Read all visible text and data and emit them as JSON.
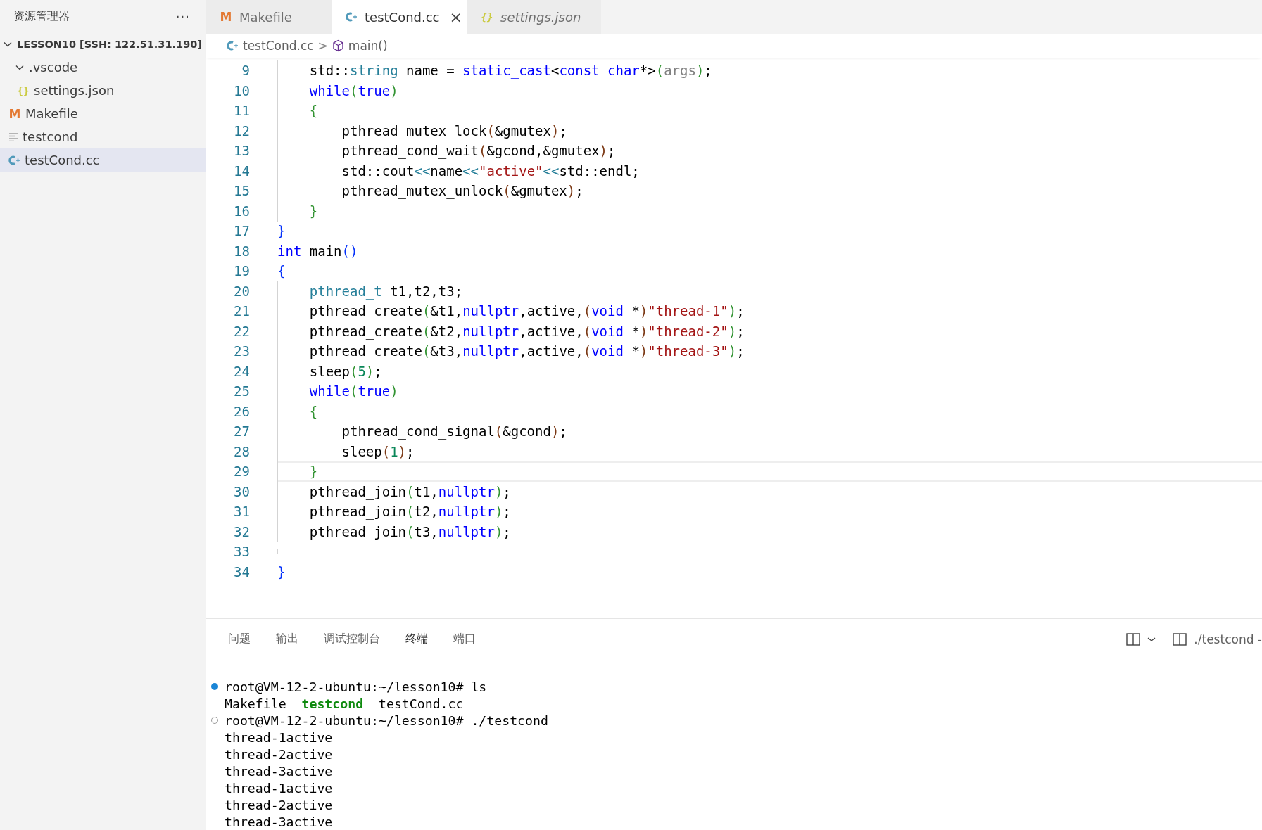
{
  "sidebar": {
    "title": "资源管理器",
    "more": "···",
    "tree": [
      {
        "label": "LESSON10 [SSH: 122.51.31.190]",
        "kind": "root",
        "expanded": true,
        "selected": false,
        "children": [
          {
            "label": ".vscode",
            "kind": "folder",
            "expanded": true,
            "selected": false,
            "children": [
              {
                "label": "settings.json",
                "kind": "json",
                "glyph": "{}",
                "selected": false
              }
            ]
          },
          {
            "label": "Makefile",
            "kind": "make",
            "glyph": "M",
            "selected": false
          },
          {
            "label": "testcond",
            "kind": "plain",
            "selected": false
          },
          {
            "label": "testCond.cc",
            "kind": "cpp",
            "selected": true
          }
        ]
      }
    ]
  },
  "tabs": [
    {
      "label": "Makefile",
      "kind": "make",
      "glyph": "M",
      "selected": false,
      "preview": false
    },
    {
      "label": "testCond.cc",
      "kind": "cpp",
      "selected": true,
      "preview": false,
      "close": "×"
    },
    {
      "label": "settings.json",
      "kind": "json",
      "glyph": "{}",
      "selected": false,
      "preview": true
    }
  ],
  "breadcrumb": {
    "file": "testCond.cc",
    "separator": ">",
    "symbol": "main()"
  },
  "editor": {
    "lines": [
      {
        "children": [
          {
            "number": "9",
            "current": false,
            "tokens": [
              {
                "text": "std::",
                "kind": "plain"
              },
              {
                "text": "string",
                "kind": "type"
              },
              {
                "text": " name = ",
                "kind": "plain"
              },
              {
                "text": "static_cast",
                "kind": "keyword"
              },
              {
                "text": "<",
                "kind": "plain"
              },
              {
                "text": "const char",
                "kind": "keyword"
              },
              {
                "text": "*>",
                "kind": "plain"
              },
              {
                "text": "(",
                "kind": "bracket2"
              },
              {
                "text": "args",
                "kind": "param"
              },
              {
                "text": ")",
                "kind": "bracket2"
              },
              {
                "text": ";",
                "kind": "plain"
              }
            ]
          },
          {
            "number": "10",
            "current": false,
            "tokens": [
              {
                "text": "while",
                "kind": "keyword"
              },
              {
                "text": "(",
                "kind": "bracket2"
              },
              {
                "text": "true",
                "kind": "keyword"
              },
              {
                "text": ")",
                "kind": "bracket2"
              }
            ]
          },
          {
            "number": "11",
            "current": false,
            "tokens": [
              {
                "text": "{",
                "kind": "bracket2"
              }
            ],
            "children": [
              {
                "number": "12",
                "current": false,
                "tokens": [
                  {
                    "text": "pthread_mutex_lock",
                    "kind": "plain"
                  },
                  {
                    "text": "(",
                    "kind": "bracket3"
                  },
                  {
                    "text": "&gmutex",
                    "kind": "plain"
                  },
                  {
                    "text": ")",
                    "kind": "bracket3"
                  },
                  {
                    "text": ";",
                    "kind": "plain"
                  }
                ]
              },
              {
                "number": "13",
                "current": false,
                "tokens": [
                  {
                    "text": "pthread_cond_wait",
                    "kind": "plain"
                  },
                  {
                    "text": "(",
                    "kind": "bracket3"
                  },
                  {
                    "text": "&gcond,&gmutex",
                    "kind": "plain"
                  },
                  {
                    "text": ")",
                    "kind": "bracket3"
                  },
                  {
                    "text": ";",
                    "kind": "plain"
                  }
                ]
              },
              {
                "number": "14",
                "current": false,
                "tokens": [
                  {
                    "text": "std::cout",
                    "kind": "plain"
                  },
                  {
                    "text": "<<",
                    "kind": "type"
                  },
                  {
                    "text": "name",
                    "kind": "plain"
                  },
                  {
                    "text": "<<",
                    "kind": "type"
                  },
                  {
                    "text": "\"active\"",
                    "kind": "string"
                  },
                  {
                    "text": "<<",
                    "kind": "type"
                  },
                  {
                    "text": "std::endl;",
                    "kind": "plain"
                  }
                ]
              },
              {
                "number": "15",
                "current": false,
                "tokens": [
                  {
                    "text": "pthread_mutex_unlock",
                    "kind": "plain"
                  },
                  {
                    "text": "(",
                    "kind": "bracket3"
                  },
                  {
                    "text": "&gmutex",
                    "kind": "plain"
                  },
                  {
                    "text": ")",
                    "kind": "bracket3"
                  },
                  {
                    "text": ";",
                    "kind": "plain"
                  }
                ]
              }
            ]
          },
          {
            "number": "16",
            "current": false,
            "tokens": [
              {
                "text": "}",
                "kind": "bracket2"
              }
            ]
          }
        ]
      },
      {
        "number": "17",
        "current": false,
        "tokens": [
          {
            "text": "}",
            "kind": "bracket1"
          }
        ]
      },
      {
        "number": "18",
        "current": false,
        "tokens": [
          {
            "text": "int",
            "kind": "keyword"
          },
          {
            "text": " main",
            "kind": "plain"
          },
          {
            "text": "()",
            "kind": "bracket1"
          }
        ]
      },
      {
        "number": "19",
        "current": false,
        "tokens": [
          {
            "text": "{",
            "kind": "bracket1"
          }
        ],
        "children": [
          {
            "number": "20",
            "current": false,
            "tokens": [
              {
                "text": "pthread_t",
                "kind": "type"
              },
              {
                "text": " t1,t2,t3;",
                "kind": "plain"
              }
            ]
          },
          {
            "number": "21",
            "current": false,
            "tokens": [
              {
                "text": "pthread_create",
                "kind": "plain"
              },
              {
                "text": "(",
                "kind": "bracket2"
              },
              {
                "text": "&t1,",
                "kind": "plain"
              },
              {
                "text": "nullptr",
                "kind": "keyword"
              },
              {
                "text": ",active,",
                "kind": "plain"
              },
              {
                "text": "(",
                "kind": "bracket3"
              },
              {
                "text": "void",
                "kind": "keyword"
              },
              {
                "text": " *",
                "kind": "plain"
              },
              {
                "text": ")",
                "kind": "bracket3"
              },
              {
                "text": "\"thread-1\"",
                "kind": "string"
              },
              {
                "text": ")",
                "kind": "bracket2"
              },
              {
                "text": ";",
                "kind": "plain"
              }
            ]
          },
          {
            "number": "22",
            "current": false,
            "tokens": [
              {
                "text": "pthread_create",
                "kind": "plain"
              },
              {
                "text": "(",
                "kind": "bracket2"
              },
              {
                "text": "&t2,",
                "kind": "plain"
              },
              {
                "text": "nullptr",
                "kind": "keyword"
              },
              {
                "text": ",active,",
                "kind": "plain"
              },
              {
                "text": "(",
                "kind": "bracket3"
              },
              {
                "text": "void",
                "kind": "keyword"
              },
              {
                "text": " *",
                "kind": "plain"
              },
              {
                "text": ")",
                "kind": "bracket3"
              },
              {
                "text": "\"thread-2\"",
                "kind": "string"
              },
              {
                "text": ")",
                "kind": "bracket2"
              },
              {
                "text": ";",
                "kind": "plain"
              }
            ]
          },
          {
            "number": "23",
            "current": false,
            "tokens": [
              {
                "text": "pthread_create",
                "kind": "plain"
              },
              {
                "text": "(",
                "kind": "bracket2"
              },
              {
                "text": "&t3,",
                "kind": "plain"
              },
              {
                "text": "nullptr",
                "kind": "keyword"
              },
              {
                "text": ",active,",
                "kind": "plain"
              },
              {
                "text": "(",
                "kind": "bracket3"
              },
              {
                "text": "void",
                "kind": "keyword"
              },
              {
                "text": " *",
                "kind": "plain"
              },
              {
                "text": ")",
                "kind": "bracket3"
              },
              {
                "text": "\"thread-3\"",
                "kind": "string"
              },
              {
                "text": ")",
                "kind": "bracket2"
              },
              {
                "text": ";",
                "kind": "plain"
              }
            ]
          },
          {
            "number": "24",
            "current": false,
            "tokens": [
              {
                "text": "sleep",
                "kind": "plain"
              },
              {
                "text": "(",
                "kind": "bracket2"
              },
              {
                "text": "5",
                "kind": "number"
              },
              {
                "text": ")",
                "kind": "bracket2"
              },
              {
                "text": ";",
                "kind": "plain"
              }
            ]
          },
          {
            "number": "25",
            "current": false,
            "tokens": [
              {
                "text": "while",
                "kind": "keyword"
              },
              {
                "text": "(",
                "kind": "bracket2"
              },
              {
                "text": "true",
                "kind": "keyword"
              },
              {
                "text": ")",
                "kind": "bracket2"
              }
            ]
          },
          {
            "number": "26",
            "current": false,
            "tokens": [
              {
                "text": "{",
                "kind": "bracket2"
              }
            ],
            "children": [
              {
                "number": "27",
                "current": false,
                "tokens": [
                  {
                    "text": "pthread_cond_signal",
                    "kind": "plain"
                  },
                  {
                    "text": "(",
                    "kind": "bracket3"
                  },
                  {
                    "text": "&gcond",
                    "kind": "plain"
                  },
                  {
                    "text": ")",
                    "kind": "bracket3"
                  },
                  {
                    "text": ";",
                    "kind": "plain"
                  }
                ]
              },
              {
                "number": "28",
                "current": false,
                "tokens": [
                  {
                    "text": "sleep",
                    "kind": "plain"
                  },
                  {
                    "text": "(",
                    "kind": "bracket3"
                  },
                  {
                    "text": "1",
                    "kind": "number"
                  },
                  {
                    "text": ")",
                    "kind": "bracket3"
                  },
                  {
                    "text": ";",
                    "kind": "plain"
                  }
                ]
              }
            ]
          },
          {
            "number": "29",
            "current": true,
            "tokens": [
              {
                "text": "}",
                "kind": "bracket2"
              }
            ]
          },
          {
            "number": "30",
            "current": false,
            "tokens": [
              {
                "text": "pthread_join",
                "kind": "plain"
              },
              {
                "text": "(",
                "kind": "bracket2"
              },
              {
                "text": "t1,",
                "kind": "plain"
              },
              {
                "text": "nullptr",
                "kind": "keyword"
              },
              {
                "text": ")",
                "kind": "bracket2"
              },
              {
                "text": ";",
                "kind": "plain"
              }
            ]
          },
          {
            "number": "31",
            "current": false,
            "tokens": [
              {
                "text": "pthread_join",
                "kind": "plain"
              },
              {
                "text": "(",
                "kind": "bracket2"
              },
              {
                "text": "t2,",
                "kind": "plain"
              },
              {
                "text": "nullptr",
                "kind": "keyword"
              },
              {
                "text": ")",
                "kind": "bracket2"
              },
              {
                "text": ";",
                "kind": "plain"
              }
            ]
          },
          {
            "number": "32",
            "current": false,
            "tokens": [
              {
                "text": "pthread_join",
                "kind": "plain"
              },
              {
                "text": "(",
                "kind": "bracket2"
              },
              {
                "text": "t3,",
                "kind": "plain"
              },
              {
                "text": "nullptr",
                "kind": "keyword"
              },
              {
                "text": ")",
                "kind": "bracket2"
              },
              {
                "text": ";",
                "kind": "plain"
              }
            ]
          },
          {
            "number": "33",
            "current": false
          }
        ]
      },
      {
        "number": "34",
        "current": false,
        "tokens": [
          {
            "text": "}",
            "kind": "bracket1"
          }
        ]
      }
    ]
  },
  "panel": {
    "tabs": [
      {
        "label": "问题",
        "selected": false
      },
      {
        "label": "输出",
        "selected": false
      },
      {
        "label": "调试控制台",
        "selected": false
      },
      {
        "label": "终端",
        "selected": true
      },
      {
        "label": "端口",
        "selected": false
      }
    ],
    "terminal_name": "./testcond -",
    "terminal": [
      {
        "kind": "command",
        "finished": true,
        "segments": [
          {
            "text": "root@VM-12-2-ubuntu:~/lesson10# ls",
            "kind": "plain"
          }
        ]
      },
      {
        "kind": "output",
        "segments": [
          {
            "text": "Makefile  ",
            "kind": "plain"
          },
          {
            "text": "testcond",
            "kind": "exec"
          },
          {
            "text": "  testCond.cc",
            "kind": "plain"
          }
        ]
      },
      {
        "kind": "command",
        "finished": false,
        "segments": [
          {
            "text": "root@VM-12-2-ubuntu:~/lesson10# ./testcond",
            "kind": "plain"
          }
        ]
      },
      {
        "kind": "output",
        "segments": [
          {
            "text": "thread-1active",
            "kind": "plain"
          }
        ]
      },
      {
        "kind": "output",
        "segments": [
          {
            "text": "thread-2active",
            "kind": "plain"
          }
        ]
      },
      {
        "kind": "output",
        "segments": [
          {
            "text": "thread-3active",
            "kind": "plain"
          }
        ]
      },
      {
        "kind": "output",
        "segments": [
          {
            "text": "thread-1active",
            "kind": "plain"
          }
        ]
      },
      {
        "kind": "output",
        "segments": [
          {
            "text": "thread-2active",
            "kind": "plain"
          }
        ]
      },
      {
        "kind": "output",
        "segments": [
          {
            "text": "thread-3active",
            "kind": "plain"
          }
        ]
      }
    ]
  }
}
